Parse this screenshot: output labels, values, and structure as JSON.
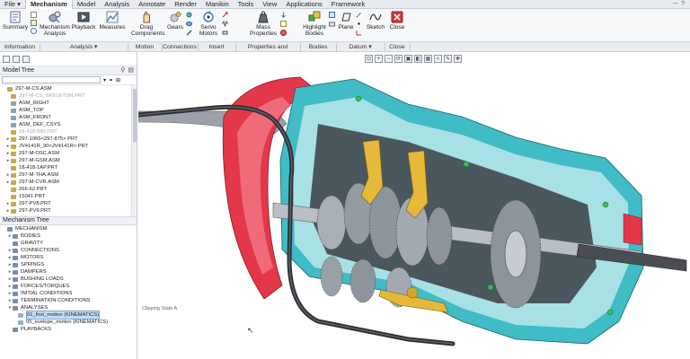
{
  "menubar": {
    "items": [
      "File",
      "Mechanism",
      "Model",
      "Analysis",
      "Annotate",
      "Render",
      "Manikin",
      "Tools",
      "View",
      "Applications",
      "Framework"
    ],
    "active_index": 1
  },
  "ribbon": {
    "summary": "Summary",
    "mechanism_analysis": [
      "Mechanism",
      "Analysis"
    ],
    "playback": "Playback",
    "measures": "Measures",
    "drag_components": [
      "Drag",
      "Components"
    ],
    "gears": "Gears",
    "servo_motors": [
      "Servo",
      "Motors"
    ],
    "mass_properties": [
      "Mass",
      "Properties"
    ],
    "highlight_bodies": [
      "Highlight",
      "Bodies"
    ],
    "plane": "Plane",
    "sketch": "Sketch",
    "close": "Close"
  },
  "groups": {
    "information": "Information",
    "analysis": "Analysis",
    "motion": "Motion",
    "connections": "Connections",
    "insert": "Insert",
    "properties": "Properties and Conditions",
    "bodies": "Bodies",
    "datum": "Datum",
    "close": "Close",
    "dropdown_glyph": "▾"
  },
  "model_tree": {
    "title": "Model Tree",
    "items": [
      {
        "label": "297-M-CS.ASM",
        "dim": false
      },
      {
        "label": "297-M-CS_SKELETON.PRT",
        "dim": true
      },
      {
        "label": "ASM_RIGHT",
        "dim": false
      },
      {
        "label": "ASM_TOP",
        "dim": false
      },
      {
        "label": "ASM_FRONT",
        "dim": false
      },
      {
        "label": "ASM_DEF_CSYS",
        "dim": false
      },
      {
        "label": "18-418-580.PRT",
        "dim": true
      },
      {
        "label": "297-1065<297-875> PRT",
        "dim": false
      },
      {
        "label": "JV4141R_90<JV4141R> PRT",
        "dim": false
      },
      {
        "label": "297-M-OSC.ASM",
        "dim": false
      },
      {
        "label": "297-M-GSM.ASM",
        "dim": false
      },
      {
        "label": "18-418-1AP.PRT",
        "dim": false
      },
      {
        "label": "297-M-THA.ASM",
        "dim": false
      },
      {
        "label": "297-M-CVR.ASM",
        "dim": false
      },
      {
        "label": "266-62.PRT",
        "dim": false
      },
      {
        "label": "15041.PRT",
        "dim": false
      },
      {
        "label": "297-PV8.PRT",
        "dim": false
      },
      {
        "label": "297-PV9.PRT",
        "dim": false
      }
    ]
  },
  "mechanism_tree": {
    "title": "Mechanism Tree",
    "items": [
      {
        "label": "MECHANISM",
        "indent": 0
      },
      {
        "label": "BODIES",
        "indent": 1
      },
      {
        "label": "GRAVITY",
        "indent": 1
      },
      {
        "label": "CONNECTIONS",
        "indent": 1
      },
      {
        "label": "MOTORS",
        "indent": 1
      },
      {
        "label": "SPRINGS",
        "indent": 1
      },
      {
        "label": "DAMPERS",
        "indent": 1
      },
      {
        "label": "BUSHING LOADS",
        "indent": 1
      },
      {
        "label": "FORCES/TORQUES",
        "indent": 1
      },
      {
        "label": "INITIAL CONDITIONS",
        "indent": 1
      },
      {
        "label": "TERMINATION CONDITIONS",
        "indent": 1
      },
      {
        "label": "ANALYSES",
        "indent": 1
      },
      {
        "label": "01_first_motion (KINEMATICS)",
        "indent": 2,
        "selected": true
      },
      {
        "label": "05_evelope_motion (KINEMATICS)",
        "indent": 2
      },
      {
        "label": "PLAYBACKS",
        "indent": 1
      }
    ]
  },
  "viewport": {
    "clipping_state": "Clipping State A"
  },
  "colors": {
    "housing_red": "#e2384a",
    "housing_cyan": "#3fbcc6",
    "gear_gray": "#8e949c",
    "fork_yellow": "#e6b93a",
    "cable": "#2b2e33"
  }
}
